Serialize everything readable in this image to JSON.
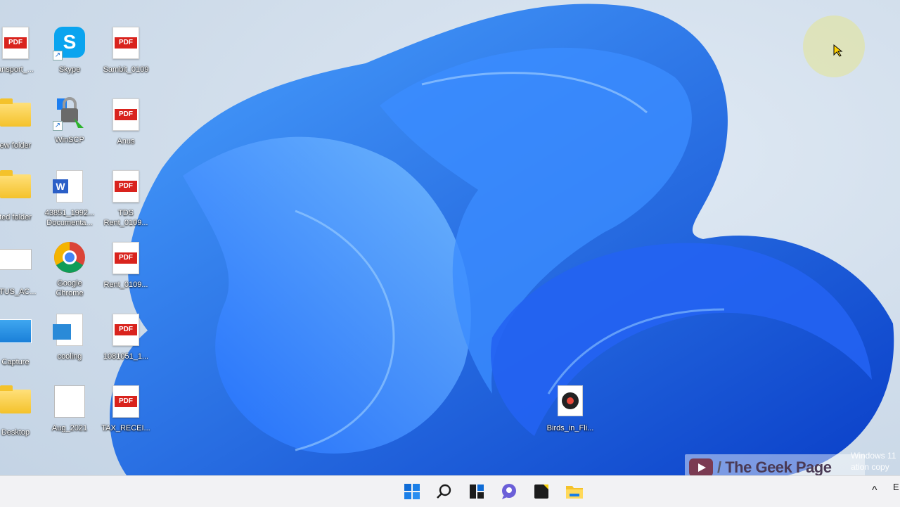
{
  "desktop": {
    "icons": [
      {
        "label": "ansport_...",
        "type": "pdf"
      },
      {
        "label": "Skype",
        "type": "skype"
      },
      {
        "label": "Sambit_0109",
        "type": "pdf"
      },
      {
        "label": "ew folder",
        "type": "folder"
      },
      {
        "label": "WinSCP",
        "type": "winscp"
      },
      {
        "label": "Anus",
        "type": "pdf"
      },
      {
        "label": "ted folder",
        "type": "folder"
      },
      {
        "label": "43851_1992...",
        "label2": "Documenta...",
        "type": "word"
      },
      {
        "label": "TDS",
        "label2": "Rent_0109...",
        "type": "pdf"
      },
      {
        "label": "ATUS_AC...",
        "type": "doc"
      },
      {
        "label": "Google",
        "label2": "Chrome",
        "type": "chrome"
      },
      {
        "label": "Rent_0109...",
        "type": "pdf"
      },
      {
        "label": "Capture",
        "type": "image"
      },
      {
        "label": "cooling",
        "type": "cooling"
      },
      {
        "label": "1081051_1...",
        "type": "pdf"
      },
      {
        "label": "Desktop",
        "type": "folder"
      },
      {
        "label": "Aug_2021",
        "type": "doc"
      },
      {
        "label": "TAX_RECEI...",
        "type": "pdf"
      },
      {
        "label": "Birds_in_Fli...",
        "type": "media"
      }
    ]
  },
  "watermark": {
    "brand": "The Geek Page"
  },
  "activation": {
    "line1": "Windows 11",
    "line2": "ation copy"
  },
  "taskbar": {
    "buttons": [
      "start",
      "search",
      "task-view",
      "chat",
      "sticky-notes",
      "file-explorer"
    ],
    "tray_chevron": "^",
    "tray_letter": "E"
  },
  "colors": {
    "accent": "#1a6fe0",
    "taskbar": "#f2f2f4",
    "pdf_red": "#d9231d"
  }
}
